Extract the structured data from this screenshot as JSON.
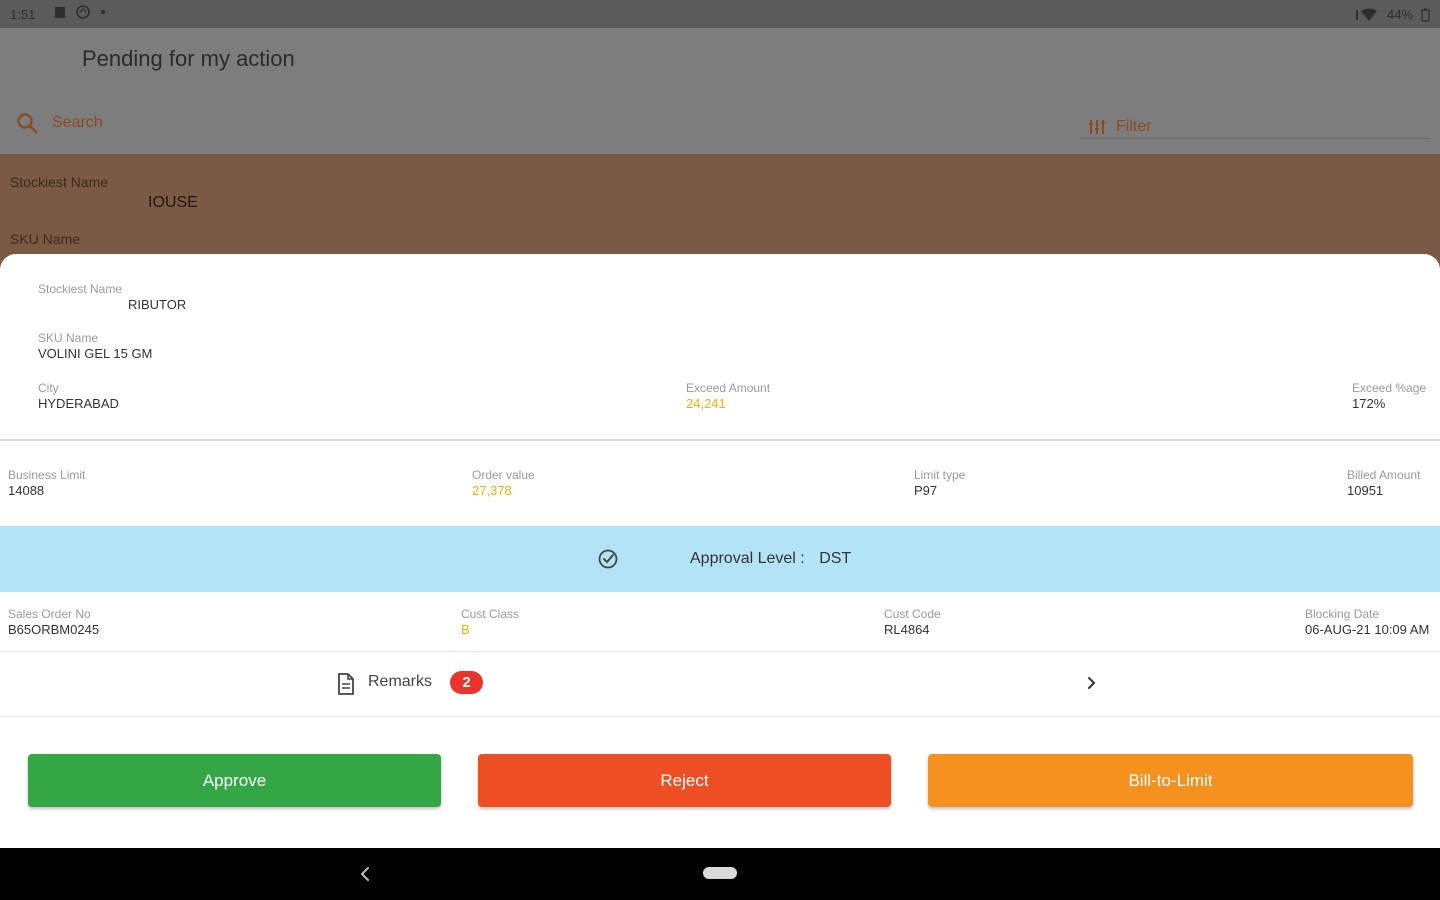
{
  "status_bar": {
    "time": "1:51",
    "battery": "44%"
  },
  "background": {
    "title": "Pending for my action",
    "search_placeholder": "Search",
    "filter_label": "Filter",
    "card": {
      "stockiest_label": "Stockiest Name",
      "stockiest_value": "IOUSE",
      "sku_label": "SKU Name"
    }
  },
  "sheet": {
    "stockiest": {
      "label": "Stockiest Name",
      "value": "RIBUTOR"
    },
    "sku": {
      "label": "SKU Name",
      "value": "VOLINI GEL 15 GM"
    },
    "city": {
      "label": "City",
      "value": "HYDERABAD"
    },
    "exceed_amount": {
      "label": "Exceed Amount",
      "value": "24,241"
    },
    "exceed_percentage": {
      "label": "Exceed %age",
      "value": "172%"
    },
    "business_limit": {
      "label": "Business Limit",
      "value": "14088"
    },
    "order_value": {
      "label": "Order value",
      "value": "27,378"
    },
    "limit_type": {
      "label": "Limit type",
      "value": "P97"
    },
    "billed_amount": {
      "label": "Billed Amount",
      "value": "10951"
    },
    "approval": {
      "label": "Approval Level :",
      "value": "DST"
    },
    "sales_order": {
      "label": "Sales Order No",
      "value": "B65ORBM0245"
    },
    "cust_class": {
      "label": "Cust Class",
      "value": "B"
    },
    "cust_code": {
      "label": "Cust Code",
      "value": "RL4864"
    },
    "blocking_date": {
      "label": "Blocking Date",
      "value": "06-AUG-21 10:09 AM"
    },
    "remarks": {
      "label": "Remarks",
      "count": "2"
    },
    "buttons": {
      "approve": "Approve",
      "reject": "Reject",
      "bill_to_limit": "Bill-to-Limit"
    }
  },
  "colors": {
    "approve": "#33a745",
    "reject": "#ee4e23",
    "bill_to_limit": "#f5921f",
    "approval_band": "#b3e3f7",
    "highlight_value": "#e2b11b",
    "badge": "#e8342b"
  },
  "icons": [
    "search-icon",
    "filter-icon",
    "check-circle-icon",
    "document-icon",
    "chevron-right-icon",
    "back-nav-icon",
    "home-pill-icon"
  ]
}
